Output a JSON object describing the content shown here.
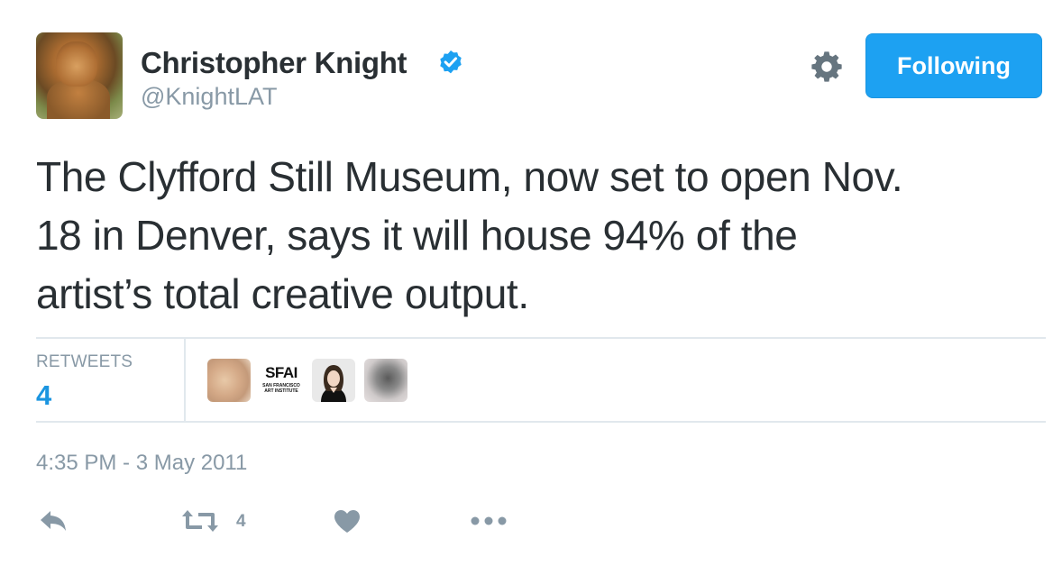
{
  "author": {
    "name": "Christopher Knight",
    "handle": "@KnightLAT",
    "verified": true
  },
  "follow_button": {
    "label": "Following"
  },
  "tweet": {
    "text_lines": [
      "The Clyfford Still Museum, now set to open Nov.",
      "18 in Denver, says it will house 94% of the",
      "artist’s total creative output."
    ]
  },
  "stats": {
    "retweets_label": "RETWEETS",
    "retweets_value": "4",
    "retweeter_avatars": [
      {
        "name": "retweeter-avatar-1"
      },
      {
        "name": "retweeter-avatar-sfai",
        "text": "SFAI",
        "subtext_1": "SAN FRANCISCO",
        "subtext_2": "ART INSTITUTE"
      },
      {
        "name": "retweeter-avatar-3"
      },
      {
        "name": "retweeter-avatar-4"
      }
    ]
  },
  "timestamp": "4:35 PM - 3 May 2011",
  "actions": {
    "retweet_count": "4"
  },
  "colors": {
    "accent": "#1da1f2",
    "link_blue": "#1b95e0",
    "text": "#292f33",
    "muted": "#8899a6",
    "divider": "#e1e8ed"
  },
  "icons": {
    "verified": "verified-badge-icon",
    "settings": "gear-icon",
    "reply": "reply-icon",
    "retweet": "retweet-icon",
    "like": "heart-icon",
    "more": "more-dots-icon"
  }
}
